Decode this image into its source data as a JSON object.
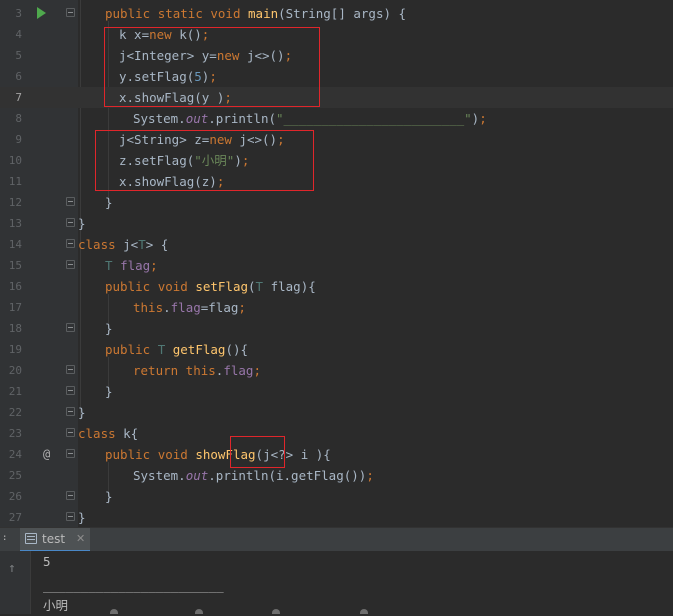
{
  "editor": {
    "lines": [
      {
        "num": "3",
        "tokens": [
          [
            "kw",
            "public "
          ],
          [
            "kw",
            "static "
          ],
          [
            "kw",
            "void "
          ],
          [
            "fn",
            "main"
          ],
          [
            "p",
            "(String[] args) {"
          ]
        ]
      },
      {
        "num": "4",
        "tokens": [
          [
            "p",
            "k x="
          ],
          [
            "kw",
            "new "
          ],
          [
            "p",
            "k()"
          ],
          [
            "kw",
            ";"
          ]
        ]
      },
      {
        "num": "5",
        "tokens": [
          [
            "p",
            "j<Integer> y="
          ],
          [
            "kw",
            "new "
          ],
          [
            "p",
            "j<>()"
          ],
          [
            "kw",
            ";"
          ]
        ]
      },
      {
        "num": "6",
        "tokens": [
          [
            "p",
            "y.setFlag("
          ],
          [
            "num",
            "5"
          ],
          [
            "p",
            ")"
          ],
          [
            "kw",
            ";"
          ]
        ]
      },
      {
        "num": "7",
        "tokens": [
          [
            "p",
            "x.showFlag(y )"
          ],
          [
            "kw",
            ";"
          ]
        ]
      },
      {
        "num": "8",
        "tokens": [
          [
            "p",
            "System."
          ],
          [
            "st",
            "out"
          ],
          [
            "p",
            ".println("
          ],
          [
            "str",
            "\"________________________\""
          ],
          [
            "p",
            ")"
          ],
          [
            "kw",
            ";"
          ]
        ]
      },
      {
        "num": "9",
        "tokens": [
          [
            "p",
            "j<String> z="
          ],
          [
            "kw",
            "new "
          ],
          [
            "p",
            "j<>()"
          ],
          [
            "kw",
            ";"
          ]
        ]
      },
      {
        "num": "10",
        "tokens": [
          [
            "p",
            "z.setFlag("
          ],
          [
            "str",
            "\"小明\""
          ],
          [
            "p",
            ")"
          ],
          [
            "kw",
            ";"
          ]
        ]
      },
      {
        "num": "11",
        "tokens": [
          [
            "p",
            "x.showFlag(z)"
          ],
          [
            "kw",
            ";"
          ]
        ]
      },
      {
        "num": "12",
        "tokens": [
          [
            "p",
            "}"
          ]
        ]
      },
      {
        "num": "13",
        "tokens": [
          [
            "p",
            "}"
          ]
        ]
      },
      {
        "num": "14",
        "tokens": [
          [
            "kw",
            "class "
          ],
          [
            "p",
            "j<"
          ],
          [
            "tp",
            "T"
          ],
          [
            "p",
            "> {"
          ]
        ]
      },
      {
        "num": "15",
        "tokens": [
          [
            "tp",
            "T "
          ],
          [
            "fld",
            "flag"
          ],
          [
            "kw",
            ";"
          ]
        ]
      },
      {
        "num": "16",
        "tokens": [
          [
            "kw",
            "public "
          ],
          [
            "kw",
            "void "
          ],
          [
            "fn",
            "setFlag"
          ],
          [
            "p",
            "("
          ],
          [
            "tp",
            "T "
          ],
          [
            "p",
            "flag){"
          ]
        ]
      },
      {
        "num": "17",
        "tokens": [
          [
            "kw",
            "this"
          ],
          [
            "p",
            "."
          ],
          [
            "fld",
            "flag"
          ],
          [
            "p",
            "=flag"
          ],
          [
            "kw",
            ";"
          ]
        ]
      },
      {
        "num": "18",
        "tokens": [
          [
            "p",
            "}"
          ]
        ]
      },
      {
        "num": "19",
        "tokens": [
          [
            "kw",
            "public "
          ],
          [
            "tp",
            "T "
          ],
          [
            "fn",
            "getFlag"
          ],
          [
            "p",
            "(){"
          ]
        ]
      },
      {
        "num": "20",
        "tokens": [
          [
            "kw",
            "return this"
          ],
          [
            "p",
            "."
          ],
          [
            "fld",
            "flag"
          ],
          [
            "kw",
            ";"
          ]
        ]
      },
      {
        "num": "21",
        "tokens": [
          [
            "p",
            "}"
          ]
        ]
      },
      {
        "num": "22",
        "tokens": [
          [
            "p",
            "}"
          ]
        ]
      },
      {
        "num": "23",
        "tokens": [
          [
            "kw",
            "class "
          ],
          [
            "p",
            "k{"
          ]
        ]
      },
      {
        "num": "24",
        "tokens": [
          [
            "kw",
            "public "
          ],
          [
            "kw",
            "void "
          ],
          [
            "fn",
            "showFlag"
          ],
          [
            "p",
            "(j<?> i ){"
          ]
        ]
      },
      {
        "num": "25",
        "tokens": [
          [
            "p",
            "System."
          ],
          [
            "st",
            "out"
          ],
          [
            "p",
            ".println(i.getFlag())"
          ],
          [
            "kw",
            ";"
          ]
        ]
      },
      {
        "num": "26",
        "tokens": [
          [
            "p",
            "}"
          ]
        ]
      },
      {
        "num": "27",
        "tokens": [
          [
            "p",
            "}"
          ]
        ]
      }
    ],
    "current_line": "7",
    "gutter_at_symbol": "@"
  },
  "run_panel": {
    "left_edge_label": ":",
    "tab_label": "test",
    "tab_close": "✕",
    "up_icon": "↑",
    "output": [
      "5",
      "________________________",
      "小明"
    ]
  },
  "icons": {
    "run": "run-gutter-icon",
    "override": "override-icon",
    "fold": "fold-icon",
    "console_tab": "console-tab-icon",
    "up": "up-arrow-icon"
  },
  "colors": {
    "background": "#2b2b2b",
    "keyword": "#cc7832",
    "method": "#ffc66d",
    "string": "#6a8759",
    "number": "#6897bb",
    "field": "#9876aa",
    "highlight_box": "#e0262b"
  }
}
